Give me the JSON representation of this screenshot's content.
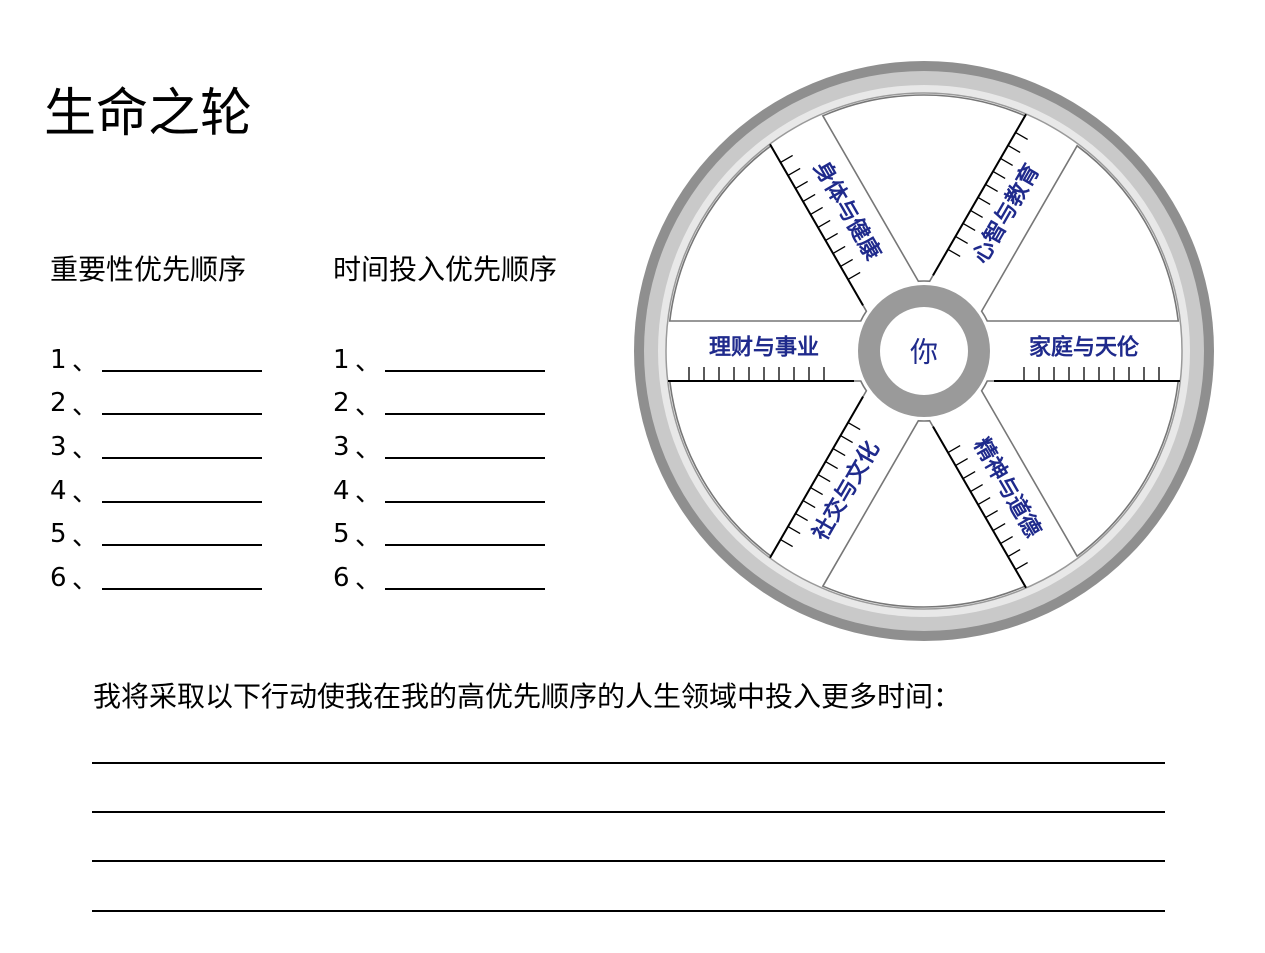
{
  "title": "生命之轮",
  "columns": [
    {
      "heading": "重要性优先顺序",
      "items": [
        "1",
        "2",
        "3",
        "4",
        "5",
        "6"
      ]
    },
    {
      "heading": "时间投入优先顺序",
      "items": [
        "1",
        "2",
        "3",
        "4",
        "5",
        "6"
      ]
    }
  ],
  "list_separator": "、",
  "wheel": {
    "center_label": "你",
    "categories": [
      "身体与健康",
      "心智与教育",
      "家庭与天伦",
      "精神与道德",
      "社交与文化",
      "理财与事业"
    ],
    "colors": {
      "rim_outer": "#8f8f8f",
      "rim_band": "#c9c9c9",
      "rim_inner": "#e8e8e8",
      "hub": "#9a9a9a",
      "label": "#1f2a8c"
    }
  },
  "action_prompt": "我将采取以下行动使我在我的高优先顺序的人生领域中投入更多时间："
}
